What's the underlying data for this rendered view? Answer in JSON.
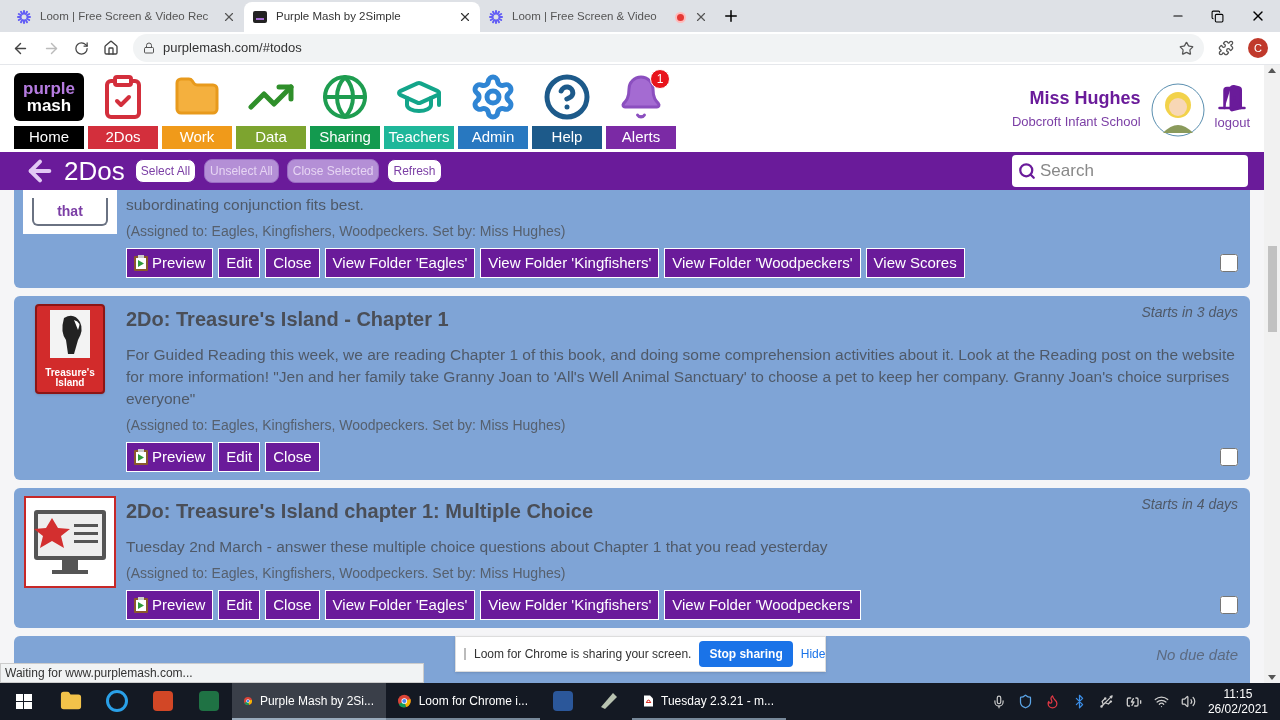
{
  "browser": {
    "tabs": [
      {
        "title": "Loom | Free Screen & Video Rec",
        "kind": "loom",
        "selected": false,
        "recording": false
      },
      {
        "title": "Purple Mash by 2Simple",
        "kind": "mash",
        "selected": true,
        "recording": false
      },
      {
        "title": "Loom | Free Screen & Video",
        "kind": "loom",
        "selected": false,
        "recording": true
      }
    ],
    "url": "purplemash.com/#todos",
    "profile": "C"
  },
  "header": {
    "logo": [
      "purple",
      "mash"
    ],
    "nav": [
      {
        "label": "Home",
        "kind": "logo",
        "color": "#000000"
      },
      {
        "label": "2Dos",
        "kind": "clipboard",
        "color": "#d32f3c"
      },
      {
        "label": "Work",
        "kind": "folder",
        "color": "#f09a1a"
      },
      {
        "label": "Data",
        "kind": "chart",
        "color": "#7da42f"
      },
      {
        "label": "Sharing",
        "kind": "globe",
        "color": "#139a4f"
      },
      {
        "label": "Teachers",
        "kind": "cap",
        "color": "#1fb79a"
      },
      {
        "label": "Admin",
        "kind": "gear",
        "color": "#2878c0"
      },
      {
        "label": "Help",
        "kind": "help",
        "color": "#1d5a8a"
      },
      {
        "label": "Alerts",
        "kind": "bell",
        "color": "#7b2aa5",
        "badge": "1"
      }
    ],
    "user": {
      "name": "Miss Hughes",
      "school": "Dobcroft Infant School",
      "logout": "logout"
    }
  },
  "toolbar": {
    "title": "2Dos",
    "buttons": [
      {
        "label": "Select All",
        "disabled": false
      },
      {
        "label": "Unselect All",
        "disabled": true
      },
      {
        "label": "Close Selected",
        "disabled": true
      },
      {
        "label": "Refresh",
        "disabled": false
      }
    ],
    "search": {
      "placeholder": "Search"
    }
  },
  "cards": [
    {
      "kind": "word",
      "icon_text": "that",
      "description": "subordinating conjunction fits best.",
      "assigned": "(Assigned to: Eagles, Kingfishers, Woodpeckers. Set by: Miss Hughes)",
      "checked": false,
      "buttons": [
        {
          "label": "Preview",
          "kind": "preview"
        },
        {
          "label": "Edit",
          "kind": "plain"
        },
        {
          "label": "Close",
          "kind": "plain"
        },
        {
          "label": "View Folder 'Eagles'",
          "kind": "plain"
        },
        {
          "label": "View Folder 'Kingfishers'",
          "kind": "plain"
        },
        {
          "label": "View Folder 'Woodpeckers'",
          "kind": "plain"
        },
        {
          "label": "View Scores",
          "kind": "plain"
        }
      ]
    },
    {
      "kind": "book",
      "icon_text": "Treasure's Island",
      "title": "2Do: Treasure's Island - Chapter 1",
      "due": "Starts in 3 days",
      "description": "For Guided Reading this week, we are reading Chapter 1 of this book, and doing some comprehension activities about it. Look at the Reading post on the website for more information! \"Jen and her family take Granny Joan to 'All's Well Animal Sanctuary' to choose a pet to keep her company. Granny Joan's choice surprises everyone\"",
      "assigned": "(Assigned to: Eagles, Kingfishers, Woodpeckers. Set by: Miss Hughes)",
      "checked": false,
      "buttons": [
        {
          "label": "Preview",
          "kind": "preview"
        },
        {
          "label": "Edit",
          "kind": "plain"
        },
        {
          "label": "Close",
          "kind": "plain"
        }
      ]
    },
    {
      "kind": "quiz",
      "title": "2Do: Treasure's Island chapter 1: Multiple Choice",
      "due": "Starts in 4 days",
      "description": "Tuesday 2nd March - answer these multiple choice questions about Chapter 1 that you read yesterday",
      "assigned": "(Assigned to: Eagles, Kingfishers, Woodpeckers. Set by: Miss Hughes)",
      "checked": false,
      "buttons": [
        {
          "label": "Preview",
          "kind": "preview"
        },
        {
          "label": "Edit",
          "kind": "plain"
        },
        {
          "label": "Close",
          "kind": "plain"
        },
        {
          "label": "View Folder 'Eagles'",
          "kind": "plain"
        },
        {
          "label": "View Folder 'Kingfishers'",
          "kind": "plain"
        },
        {
          "label": "View Folder 'Woodpeckers'",
          "kind": "plain"
        }
      ]
    },
    {
      "kind": "stub",
      "due": "No due date"
    }
  ],
  "status": "Waiting for www.purplemash.com...",
  "share_bar": {
    "text": "Loom for Chrome is sharing your screen.",
    "stop": "Stop sharing",
    "hide": "Hide"
  },
  "taskbar": {
    "apps": [
      {
        "kind": "explorer",
        "selected": false
      },
      {
        "kind": "ie",
        "selected": false
      },
      {
        "kind": "powerpoint",
        "selected": false
      },
      {
        "kind": "excel",
        "selected": false
      },
      {
        "kind": "chrome",
        "label": "Purple Mash by 2Si...",
        "selected": true
      },
      {
        "kind": "chrome",
        "label": "Loom for Chrome i...",
        "selected": false
      },
      {
        "kind": "word",
        "selected": false
      },
      {
        "kind": "tool",
        "selected": false
      },
      {
        "kind": "pdf",
        "label": "Tuesday 2.3.21 - m...",
        "selected": false
      }
    ],
    "time": "11:15",
    "date": "26/02/2021"
  }
}
